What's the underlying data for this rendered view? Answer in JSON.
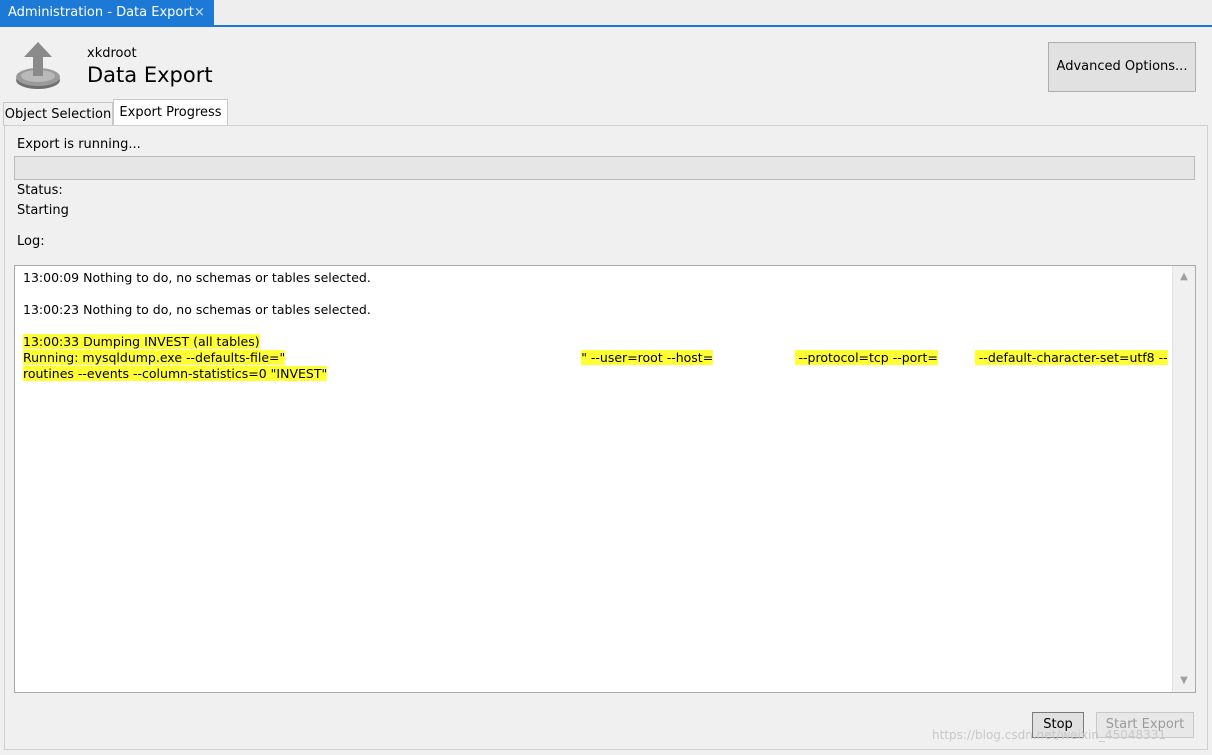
{
  "doc_tab": {
    "title": "Administration - Data Export",
    "close": "×"
  },
  "header": {
    "connection": "xkdroot",
    "title": "Data Export",
    "icon": "export-upload-icon"
  },
  "advanced_button": "Advanced Options...",
  "tabs": [
    {
      "label": "Object Selection",
      "active": false
    },
    {
      "label": "Export Progress",
      "active": true
    }
  ],
  "progress": {
    "running_label": "Export is running...",
    "fill_fraction": 0.0,
    "status_label": "Status:",
    "status_value": "Starting",
    "log_label": "Log:"
  },
  "log": {
    "line1": "13:00:09 Nothing to do, no schemas or tables selected.",
    "line2": "13:00:23 Nothing to do, no schemas or tables selected.",
    "line3": "13:00:33 Dumping INVEST (all tables)",
    "running_prefix": "Running: mysqldump.exe --defaults-file=\"",
    "user_host": "\" --user=root --host=",
    "protocol": " --protocol=tcp --port=",
    "charset": " --default-character-set=utf8 --",
    "line5": "routines --events --column-statistics=0 \"INVEST\""
  },
  "buttons": {
    "stop": "Stop",
    "start": "Start Export"
  },
  "watermark": "https://blog.csdn.net/weixin_45048331",
  "colors": {
    "accent": "#1c7ad6",
    "highlight": "#ffff33",
    "progress": "#06b025"
  }
}
